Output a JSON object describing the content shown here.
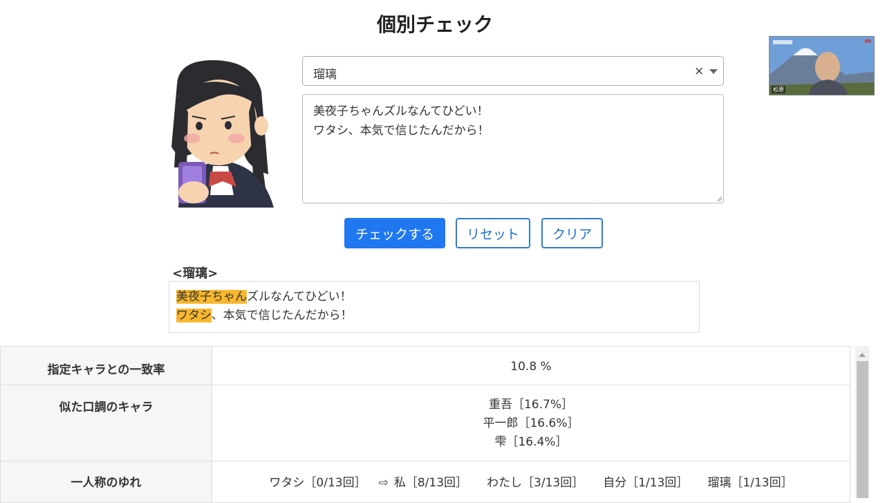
{
  "page": {
    "title": "個別チェック"
  },
  "form": {
    "character_select": {
      "value": "瑠璃",
      "clear_symbol": "×"
    },
    "text_input": {
      "lines": [
        "美夜子ちゃんズルなんてひどい！",
        "ワタシ、本気で信じたんだから！"
      ]
    },
    "buttons": {
      "check": "チェックする",
      "reset": "リセット",
      "clear": "クリア"
    }
  },
  "result": {
    "label": "<瑠璃>",
    "lines": [
      {
        "highlight": "美夜子ちゃん",
        "rest": "ズルなんてひどい！"
      },
      {
        "highlight": "ワタシ",
        "rest": "、本気で信じたんだから！"
      }
    ]
  },
  "stats": {
    "match_rate": {
      "label": "指定キャラとの一致率",
      "value": "10.8 %"
    },
    "similar": {
      "label": "似た口調のキャラ",
      "items": [
        "重吾［16.7%］",
        "平一郎［16.6%］",
        "雫［16.4%］"
      ]
    },
    "first_person": {
      "label": "一人称のゆれ",
      "current": "ワタシ［0/13回］",
      "arrow": "⇨",
      "items": [
        "私［8/13回］",
        "わたし［3/13回］",
        "自分［1/13回］",
        "瑠璃［1/13回］"
      ]
    }
  },
  "video": {
    "name": "松原",
    "logo": "m"
  },
  "colors": {
    "primary": "#1f78f0",
    "highlight": "#f8b72c",
    "outline": "#2d7bd8"
  }
}
